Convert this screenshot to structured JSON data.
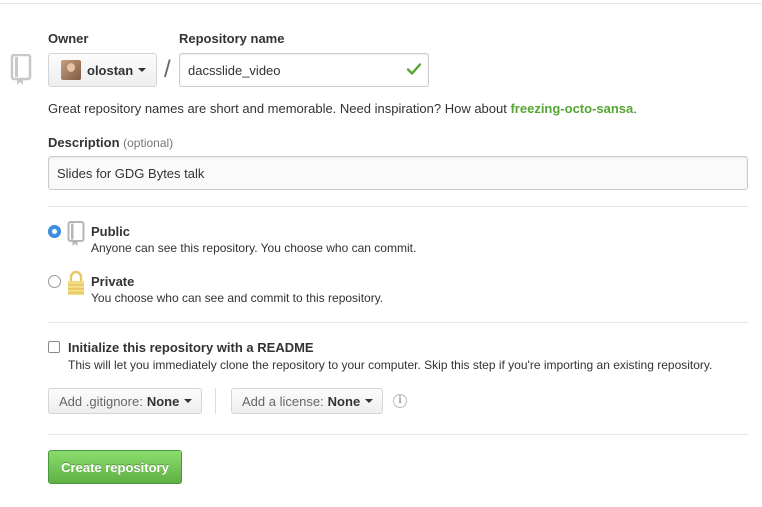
{
  "owner": {
    "label": "Owner",
    "value": "olostan"
  },
  "repository_name": {
    "label": "Repository name",
    "value": "dacsslide_video",
    "separator": "/"
  },
  "hint": {
    "text": "Great repository names are short and memorable. Need inspiration? How about ",
    "suggestion": "freezing-octo-sansa",
    "suffix": "."
  },
  "description": {
    "label": "Description",
    "optional": "(optional)",
    "value": "Slides for GDG Bytes talk"
  },
  "visibility": {
    "public": {
      "title": "Public",
      "desc": "Anyone can see this repository. You choose who can commit.",
      "selected": true
    },
    "private": {
      "title": "Private",
      "desc": "You choose who can see and commit to this repository.",
      "selected": false
    }
  },
  "init_readme": {
    "title": "Initialize this repository with a README",
    "desc": "This will let you immediately clone the repository to your computer. Skip this step if you're importing an existing repository.",
    "checked": false
  },
  "gitignore": {
    "label": "Add .gitignore:",
    "value": "None"
  },
  "license": {
    "label": "Add a license:",
    "value": "None"
  },
  "info_icon": "i",
  "create_button": "Create repository",
  "colors": {
    "accent_green": "#60b044",
    "suggestion_green": "#55a532",
    "radio_blue": "#3b8ee6"
  }
}
